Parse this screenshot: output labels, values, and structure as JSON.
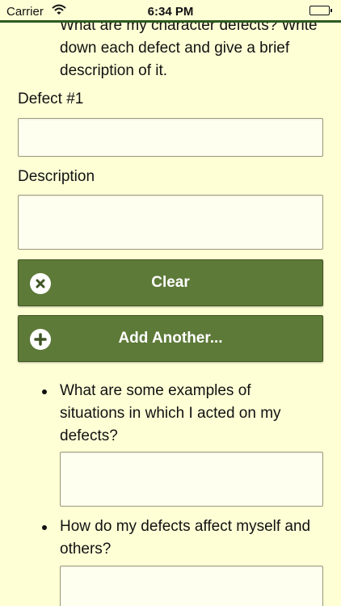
{
  "status_bar": {
    "carrier": "Carrier",
    "time": "6:34 PM",
    "battery_level": 1.0
  },
  "intro_question": "What are my character defects? Write down each defect and give a brief description of it.",
  "defect_label": "Defect #1",
  "defect_value": "",
  "description_label": "Description",
  "description_value": "",
  "buttons": {
    "clear_label": "Clear",
    "add_another_label": "Add Another..."
  },
  "questions": [
    {
      "text": "What are some examples of situations in which I acted on my defects?",
      "answer": ""
    },
    {
      "text": "How do my defects affect myself and others?",
      "answer": ""
    }
  ],
  "colors": {
    "background": "#ffffd6",
    "button": "#5d7a38",
    "status_border": "#2e5a1f"
  }
}
